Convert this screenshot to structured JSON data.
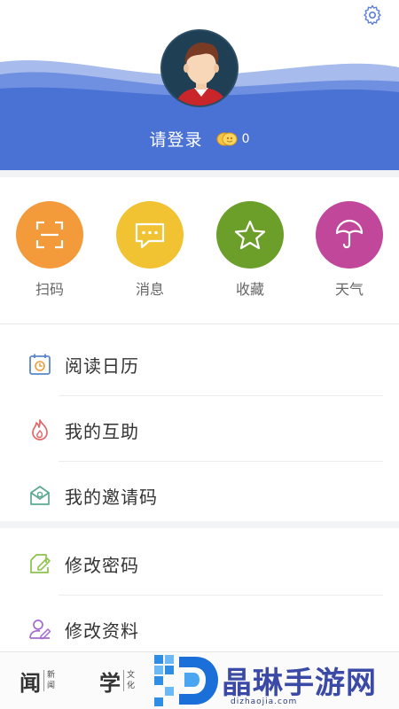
{
  "header": {
    "login_label": "请登录",
    "coin_count": "0"
  },
  "quick_actions": [
    {
      "label": "扫码",
      "color": "#f39a3a",
      "icon": "scan-icon"
    },
    {
      "label": "消息",
      "color": "#f1c232",
      "icon": "message-icon"
    },
    {
      "label": "收藏",
      "color": "#6c9e2a",
      "icon": "star-icon"
    },
    {
      "label": "天气",
      "color": "#c0479a",
      "icon": "umbrella-icon"
    }
  ],
  "menu": [
    {
      "label": "阅读日历",
      "icon": "calendar-icon"
    },
    {
      "label": "我的互助",
      "icon": "fire-icon"
    },
    {
      "label": "我的邀请码",
      "icon": "invite-icon"
    },
    {
      "label": "修改密码",
      "icon": "edit-icon"
    },
    {
      "label": "修改资料",
      "icon": "profile-edit-icon"
    }
  ],
  "bottom_tabs": [
    {
      "big": "闻",
      "small": [
        "新",
        "闻"
      ]
    },
    {
      "big": "学",
      "small": [
        "文",
        "化"
      ]
    }
  ],
  "watermark": {
    "text": "晶琳手游网",
    "url": "dizhaojia.com"
  },
  "colors": {
    "header_blue": "#4a72d4",
    "wave_light": "#7d9be3"
  }
}
